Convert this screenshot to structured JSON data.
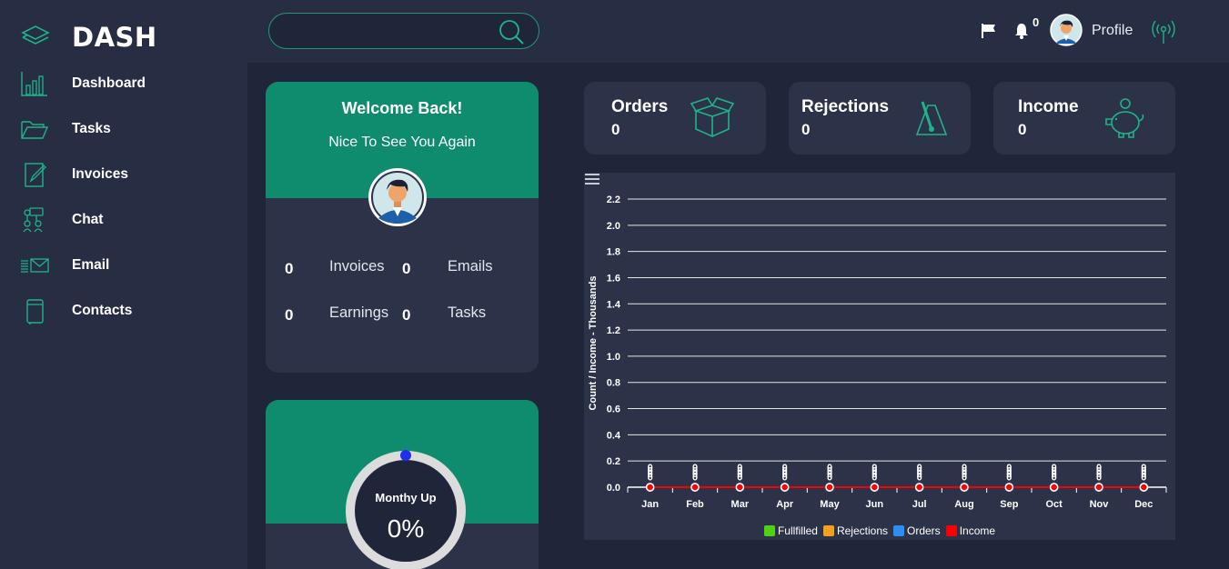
{
  "brand": {
    "name": "DASH"
  },
  "sidebar": {
    "items": [
      {
        "label": "Dashboard",
        "icon": "bar-chart-icon"
      },
      {
        "label": "Tasks",
        "icon": "folder-icon"
      },
      {
        "label": "Invoices",
        "icon": "edit-document-icon"
      },
      {
        "label": "Chat",
        "icon": "chat-network-icon"
      },
      {
        "label": "Email",
        "icon": "envelope-icon"
      },
      {
        "label": "Contacts",
        "icon": "contact-book-icon"
      }
    ]
  },
  "topbar": {
    "search": {
      "value": "",
      "placeholder": ""
    },
    "notification_count": "0",
    "profile_label": "Profile"
  },
  "welcome": {
    "title": "Welcome Back!",
    "subtitle": "Nice To See You Again",
    "stats": [
      {
        "value": "0",
        "label": "Invoices"
      },
      {
        "value": "0",
        "label": "Emails"
      },
      {
        "value": "0",
        "label": "Earnings"
      },
      {
        "value": "0",
        "label": "Tasks"
      }
    ]
  },
  "monthly": {
    "label": "Monthy Up",
    "value": "0%",
    "progress": 0
  },
  "kpis": [
    {
      "title": "Orders",
      "value": "0",
      "icon": "open-box-icon"
    },
    {
      "title": "Rejections",
      "value": "0",
      "icon": "metronome-icon"
    },
    {
      "title": "Income",
      "value": "0",
      "icon": "piggy-bank-icon"
    }
  ],
  "colors": {
    "accent": "#0f8c6d",
    "background": "#20263a",
    "panel": "#2c3349",
    "fullfilled": "#52d017",
    "rejections": "#f5a01a",
    "orders": "#2f8cf0",
    "income": "#ff0000"
  },
  "chart_data": {
    "type": "line",
    "title": "",
    "xlabel": "",
    "ylabel": "Count / Income - Thousands",
    "categories": [
      "Jan",
      "Feb",
      "Mar",
      "Apr",
      "May",
      "Jun",
      "Jul",
      "Aug",
      "Sep",
      "Oct",
      "Nov",
      "Dec"
    ],
    "ylim": [
      0,
      2.2
    ],
    "yticks": [
      "0.0",
      "0.2",
      "0.4",
      "0.6",
      "0.8",
      "1.0",
      "1.2",
      "1.4",
      "1.6",
      "1.8",
      "2.0",
      "2.2"
    ],
    "grid": true,
    "legend_position": "bottom",
    "series": [
      {
        "name": "Fullfilled",
        "color": "#52d017",
        "values": [
          0,
          0,
          0,
          0,
          0,
          0,
          0,
          0,
          0,
          0,
          0,
          0
        ]
      },
      {
        "name": "Rejections",
        "color": "#f5a01a",
        "values": [
          0,
          0,
          0,
          0,
          0,
          0,
          0,
          0,
          0,
          0,
          0,
          0
        ]
      },
      {
        "name": "Orders",
        "color": "#2f8cf0",
        "values": [
          0,
          0,
          0,
          0,
          0,
          0,
          0,
          0,
          0,
          0,
          0,
          0
        ]
      },
      {
        "name": "Income",
        "color": "#ff0000",
        "values": [
          0,
          0,
          0,
          0,
          0,
          0,
          0,
          0,
          0,
          0,
          0,
          0
        ]
      }
    ]
  }
}
